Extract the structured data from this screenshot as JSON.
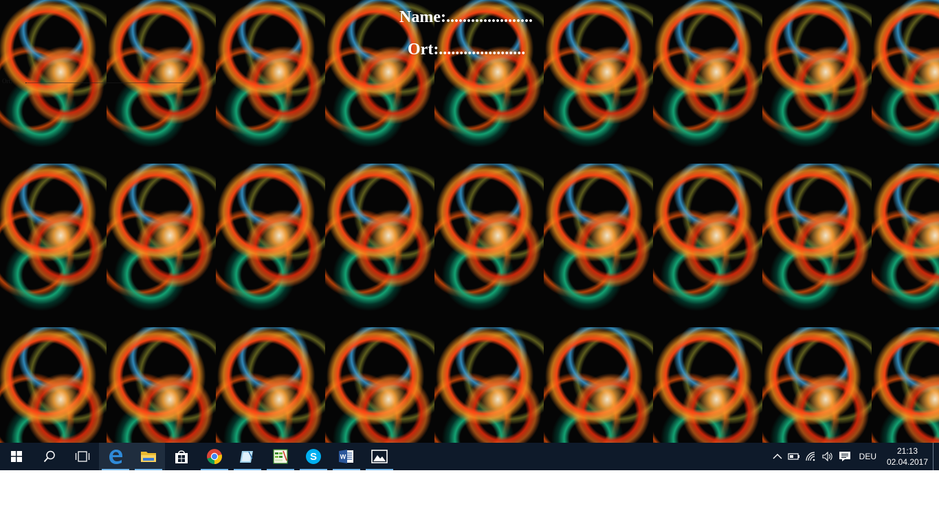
{
  "wallpaper": {
    "name_label": "Name:.....................",
    "ort_label": "Ort:.....................",
    "small_line_label": "Ort:"
  },
  "taskbar": {
    "background": "#0e1a2a",
    "running_indicator_color": "#76b9ed",
    "items": [
      {
        "icon": "start-icon"
      },
      {
        "icon": "search-icon"
      },
      {
        "icon": "task-view-icon"
      },
      {
        "icon": "edge-icon",
        "running": true,
        "active": true
      },
      {
        "icon": "file-explorer-icon",
        "running": true,
        "active": true
      },
      {
        "icon": "store-icon"
      },
      {
        "icon": "chrome-icon",
        "running": true
      },
      {
        "icon": "notepad-app-icon",
        "running": true
      },
      {
        "icon": "spreadsheet-app-icon",
        "running": true
      },
      {
        "icon": "skype-icon",
        "running": true
      },
      {
        "icon": "word-icon",
        "running": true
      },
      {
        "icon": "photos-icon",
        "running": true
      }
    ]
  },
  "tray": {
    "language": "DEU",
    "time": "21:13",
    "date": "02.04.2017"
  }
}
